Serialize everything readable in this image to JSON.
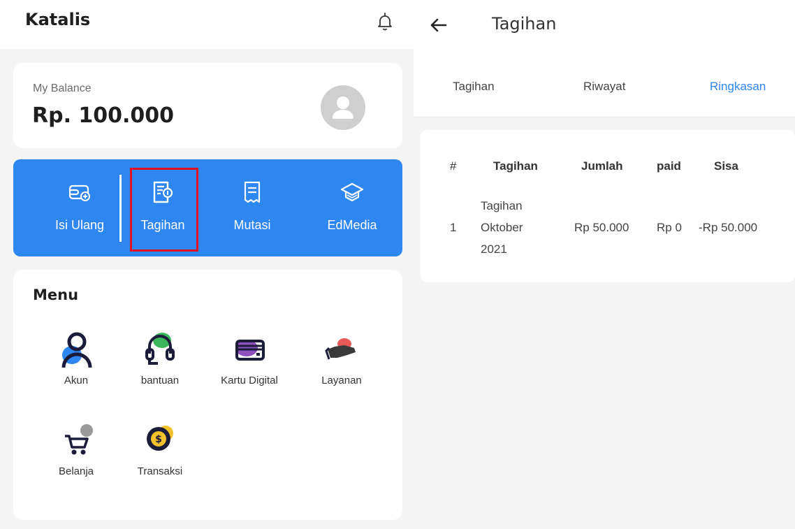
{
  "left": {
    "app_title": "Katalis",
    "balance": {
      "label": "My Balance",
      "value": "Rp. 100.000"
    },
    "actions": [
      {
        "label": "Isi Ulang",
        "icon": "wallet-add-icon"
      },
      {
        "label": "Tagihan",
        "icon": "bill-icon"
      },
      {
        "label": "Mutasi",
        "icon": "receipt-icon"
      },
      {
        "label": "EdMedia",
        "icon": "graduation-cap-icon"
      }
    ],
    "menu": {
      "title": "Menu",
      "items": [
        {
          "label": "Akun",
          "icon": "user-icon"
        },
        {
          "label": "bantuan",
          "icon": "headset-icon"
        },
        {
          "label": "Kartu Digital",
          "icon": "card-icon"
        },
        {
          "label": "Layanan",
          "icon": "hand-icon"
        },
        {
          "label": "Belanja",
          "icon": "cart-icon"
        },
        {
          "label": "Transaksi",
          "icon": "coin-icon"
        }
      ]
    }
  },
  "right": {
    "title": "Tagihan",
    "tabs": [
      {
        "label": "Tagihan"
      },
      {
        "label": "Riwayat"
      },
      {
        "label": "Ringkasan",
        "active": true
      }
    ],
    "table": {
      "headers": [
        "#",
        "Tagihan",
        "Jumlah",
        "paid",
        "Sisa"
      ],
      "rows": [
        {
          "no": "1",
          "tagihan": [
            "Tagihan",
            "Oktober",
            "2021"
          ],
          "jumlah": "Rp 50.000",
          "paid": "Rp 0",
          "sisa": "-Rp 50.000"
        }
      ]
    }
  },
  "colors": {
    "primary": "#2e86f0",
    "highlight": "#e0141f",
    "background": "#f5f5f5"
  }
}
